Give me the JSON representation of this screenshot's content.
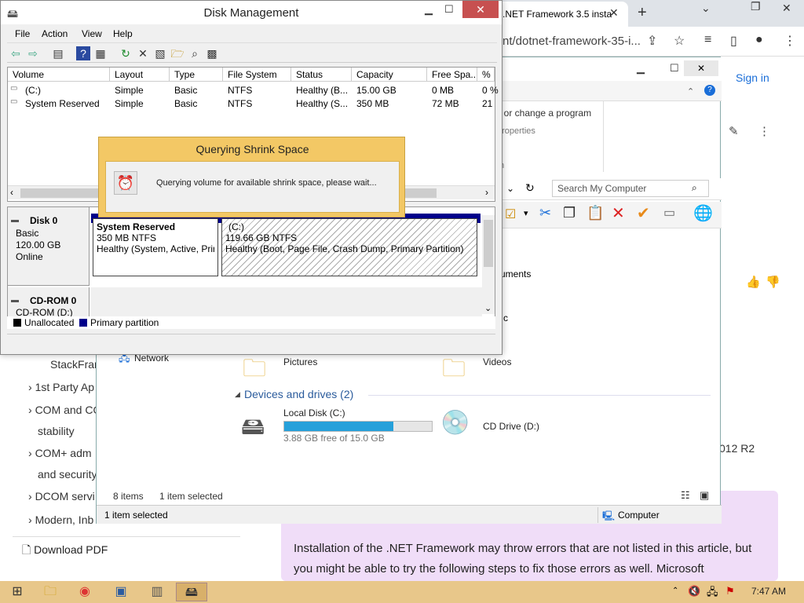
{
  "browser": {
    "tab_title": ".NET Framework 3.5 insta",
    "url": "nt/dotnet-framework-35-i...",
    "signin": "Sign in",
    "side_text": "012 R2",
    "left_nav": [
      "StackFran",
      "1st Party Ap",
      "COM and CO",
      "stability",
      "COM+ adm",
      "and security",
      "DCOM servi",
      "Modern, Inb"
    ],
    "download_pdf": "Download PDF",
    "article_text": "Installation of the .NET Framework may throw errors that are not listed in this article, but you might be able to try the following steps to fix those errors as well. Microsoft"
  },
  "explorer": {
    "ribbon": {
      "uninstall": "ll or change a program",
      "properties": "properties",
      "e": "e",
      "m": "m"
    },
    "search_placeholder": "Search My Computer",
    "side_labels": {
      "documents": "uments",
      "c": "c"
    },
    "folders": {
      "network": "Network",
      "pictures": "Pictures",
      "videos": "Videos"
    },
    "devices_header": "Devices and drives (2)",
    "drives": [
      {
        "name": "Local Disk (C:)",
        "free": "3.88 GB free of 15.0 GB",
        "used_fraction": 0.74
      },
      {
        "name": "CD Drive (D:)"
      }
    ],
    "items_count": "8 items",
    "items_selected": "1 item selected",
    "status_selected": "1 item selected",
    "status_computer": "Computer"
  },
  "disk_mgmt": {
    "title": "Disk Management",
    "menus": [
      "File",
      "Action",
      "View",
      "Help"
    ],
    "columns": [
      "Volume",
      "Layout",
      "Type",
      "File System",
      "Status",
      "Capacity",
      "Free Spa...",
      "% F"
    ],
    "volumes": [
      [
        "(C:)",
        "Simple",
        "Basic",
        "NTFS",
        "Healthy (B...",
        "15.00 GB",
        "0 MB",
        "0 %"
      ],
      [
        "System Reserved",
        "Simple",
        "Basic",
        "NTFS",
        "Healthy (S...",
        "350 MB",
        "72 MB",
        "21"
      ]
    ],
    "disk0": {
      "name": "Disk 0",
      "type": "Basic",
      "size": "120.00 GB",
      "state": "Online"
    },
    "cdrom": {
      "name": "CD-ROM 0",
      "sub": "CD-ROM (D:)"
    },
    "partitions": [
      {
        "name": "System Reserved",
        "size": "350 MB NTFS",
        "status": "Healthy (System, Active, Prir"
      },
      {
        "name": "(C:)",
        "size": "119.66 GB NTFS",
        "status": "Healthy (Boot, Page File, Crash Dump, Primary Partition)"
      }
    ],
    "legend": {
      "unallocated": "Unallocated",
      "primary": "Primary partition"
    }
  },
  "query_dialog": {
    "title": "Querying Shrink Space",
    "message": "Querying volume for available shrink space, please wait..."
  },
  "taskbar": {
    "clock": "7:47 AM"
  }
}
